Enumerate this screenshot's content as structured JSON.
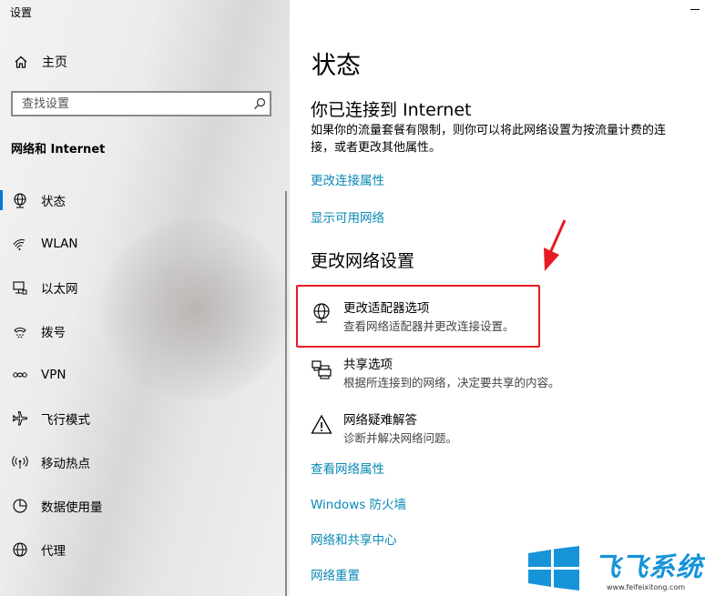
{
  "window": {
    "title": "设置"
  },
  "sidebar": {
    "home_label": "主页",
    "search_placeholder": "查找设置",
    "section_title": "网络和 Internet",
    "items": [
      {
        "label": "状态",
        "icon": "globe-icon",
        "active": true
      },
      {
        "label": "WLAN",
        "icon": "wifi-icon"
      },
      {
        "label": "以太网",
        "icon": "ethernet-icon"
      },
      {
        "label": "拨号",
        "icon": "dialup-icon"
      },
      {
        "label": "VPN",
        "icon": "vpn-icon"
      },
      {
        "label": "飞行模式",
        "icon": "airplane-icon"
      },
      {
        "label": "移动热点",
        "icon": "hotspot-icon"
      },
      {
        "label": "数据使用量",
        "icon": "data-usage-icon"
      },
      {
        "label": "代理",
        "icon": "proxy-globe-icon"
      }
    ]
  },
  "main": {
    "title": "状态",
    "connection_heading": "你已连接到 Internet",
    "connection_desc": "如果你的流量套餐有限制，则你可以将此网络设置为按流量计费的连接，或者更改其他属性。",
    "link_change_props": "更改连接属性",
    "link_show_networks": "显示可用网络",
    "change_heading": "更改网络设置",
    "options": [
      {
        "title": "更改适配器选项",
        "desc": "查看网络适配器并更改连接设置。",
        "icon": "adapter-globe-icon"
      },
      {
        "title": "共享选项",
        "desc": "根据所连接到的网络，决定要共享的内容。",
        "icon": "sharing-printer-icon"
      },
      {
        "title": "网络疑难解答",
        "desc": "诊断并解决网络问题。",
        "icon": "warning-icon"
      }
    ],
    "links": [
      "查看网络属性",
      "Windows 防火墙",
      "网络和共享中心",
      "网络重置"
    ]
  },
  "watermark": {
    "brand": "飞飞系统",
    "url": "www.feifeixitong.com"
  },
  "colors": {
    "accent": "#0078d7",
    "link": "#0a89b5",
    "highlight": "#e81b23",
    "watermark": "#1793d8"
  }
}
